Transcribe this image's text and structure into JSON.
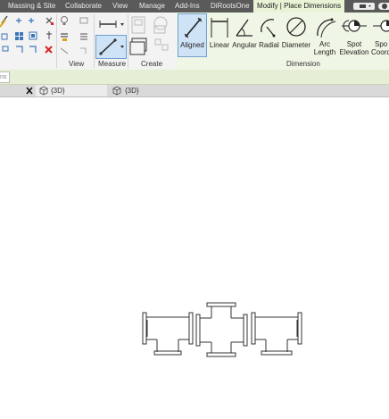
{
  "ribbon_tabs": [
    {
      "label": "Massing & Site"
    },
    {
      "label": "Collaborate"
    },
    {
      "label": "View"
    },
    {
      "label": "Manage"
    },
    {
      "label": "Add-Ins"
    },
    {
      "label": "DiRootsOne"
    },
    {
      "label": "Modify | Place Dimensions",
      "active": true
    }
  ],
  "groups": {
    "view": "View",
    "measure": "Measure",
    "create": "Create",
    "dimension": "Dimension"
  },
  "dimension_tools": [
    {
      "label": "Aligned",
      "icon": "aligned-dimension-icon",
      "selected": true
    },
    {
      "label": "Linear",
      "icon": "linear-dimension-icon"
    },
    {
      "label": "Angular",
      "icon": "angular-dimension-icon"
    },
    {
      "label": "Radial",
      "icon": "radial-dimension-icon"
    },
    {
      "label": "Diameter",
      "icon": "diameter-dimension-icon"
    },
    {
      "label": "Arc\nLength",
      "line1": "Arc",
      "line2": "Length",
      "icon": "arc-length-icon"
    },
    {
      "label": "Spot\nElevation",
      "line1": "Spot",
      "line2": "Elevation",
      "icon": "spot-elevation-icon"
    },
    {
      "label": "Spo\nCoord",
      "line1": "Spo",
      "line2": "Coord",
      "icon": "spot-coordinate-icon"
    }
  ],
  "options_bar": {
    "truncated_text": "ns"
  },
  "view_tabs": [
    {
      "label": "{3D}",
      "icon": "view-3d-icon"
    },
    {
      "label": "{3D}",
      "icon": "view-3d-icon"
    }
  ],
  "colors": {
    "tabbar": "#5a5a5a",
    "active_tab": "#e9f3d6",
    "selected_tool": "#cfe3f7",
    "options_bar": "#e6efd6",
    "drawing_lines": "#333333"
  }
}
